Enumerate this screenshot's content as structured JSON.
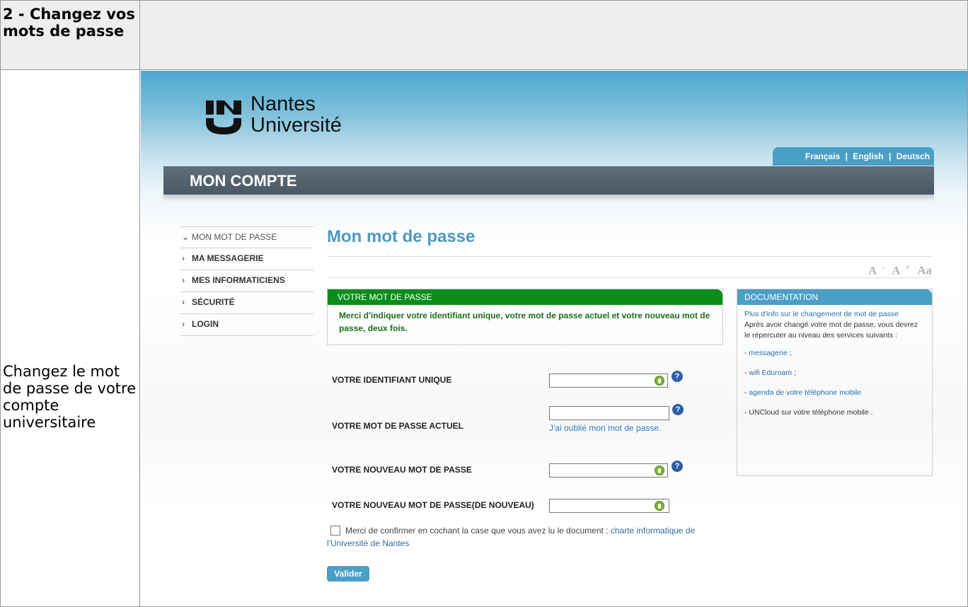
{
  "doc": {
    "step_title": "2 - Changez vos mots de passe",
    "step_desc": "Changez le mot de passe de votre compte universitaire"
  },
  "site": {
    "logo_line1": "Nantes",
    "logo_line2": "Université",
    "languages": [
      "Français",
      "English",
      "Deutsch"
    ],
    "lang_sep": "|",
    "header_title": "MON COMPTE"
  },
  "nav": {
    "items": [
      {
        "label": "MON MOT DE PASSE",
        "chevron": "v",
        "active": true
      },
      {
        "label": "MA MESSAGERIE",
        "chevron": ">"
      },
      {
        "label": "MES INFORMATICIENS",
        "chevron": ">"
      },
      {
        "label": "SÉCURITÉ",
        "chevron": ">"
      },
      {
        "label": "LOGIN",
        "chevron": ">"
      }
    ]
  },
  "main": {
    "title": "Mon mot de passe",
    "font_controls": [
      "A",
      "-",
      "A",
      "+",
      "Aa"
    ],
    "box_title": "VOTRE MOT DE PASSE",
    "box_text": "Merci d'indiquer votre identifiant unique, votre mot de passe actuel et votre nouveau mot de passe, deux fois.",
    "fields": {
      "identifiant": "VOTRE IDENTIFIANT UNIQUE",
      "actuel": "VOTRE MOT DE PASSE ACTUEL",
      "nouveau": "VOTRE NOUVEAU MOT DE PASSE",
      "confirm": "VOTRE NOUVEAU MOT DE PASSE(DE NOUVEAU)"
    },
    "forgot_link": "J'ai oublié mon mot de passe.",
    "help_glyph": "?",
    "confirm_text": "Merci de confirmer en cochant la case que vous avez lu le document :",
    "confirm_link": "charte informatique de l'Université de Nantes",
    "submit": "Valider"
  },
  "documentation": {
    "title": "DOCUMENTATION",
    "intro_link": "Plus d'info sur le changement de mot de passe",
    "intro_text": "Après avoir changé votre mot de passe, vous devrez le répercuter au niveau des services suivants :",
    "items": [
      {
        "link": "messagerie",
        "suffix": ";"
      },
      {
        "link": "wifi Eduroam",
        "suffix": ";"
      },
      {
        "link": "agenda de votre téléphone mobile",
        "suffix": ""
      },
      {
        "text": "UNCloud sur votre téléphone mobile ."
      }
    ],
    "dash": "-"
  },
  "colors": {
    "accent": "#4a9fc7",
    "green_header": "#0a8e19",
    "green_text": "#206d1d",
    "dark_bar": "#56646f",
    "link": "#2f6ea5"
  }
}
